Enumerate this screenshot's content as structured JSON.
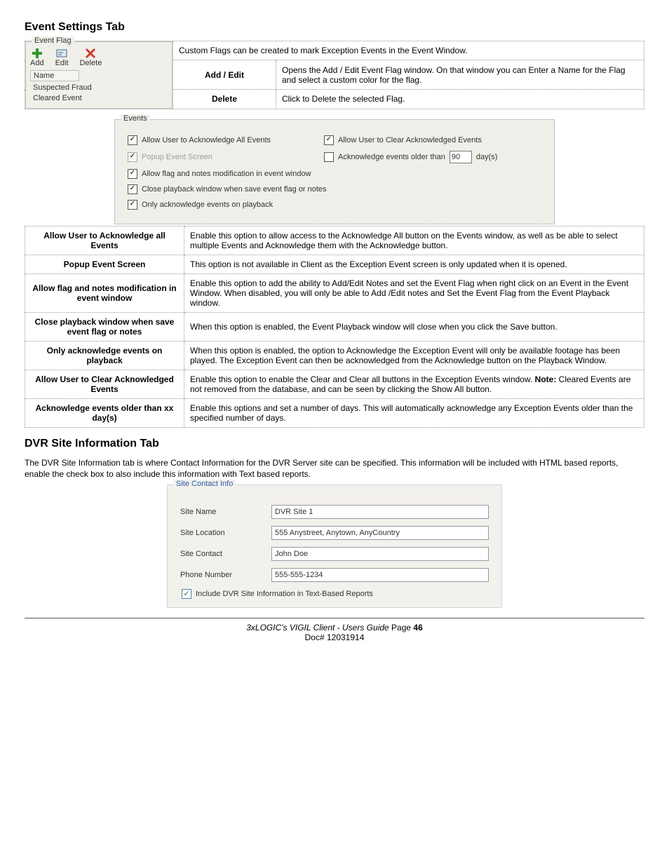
{
  "headings": {
    "event_settings": "Event Settings Tab",
    "dvr_site_info": "DVR Site Information Tab"
  },
  "flag_panel": {
    "legend": "Event Flag",
    "actions": {
      "add": "Add",
      "edit": "Edit",
      "delete": "Delete"
    },
    "list_header": "Name",
    "items": [
      "Suspected Fraud",
      "Cleared Event"
    ]
  },
  "flags_table": {
    "intro": "Custom Flags can be created to mark Exception Events in the Event Window.",
    "rows": [
      {
        "label": "Add / Edit",
        "desc": "Opens the Add / Edit Event Flag window.  On that window you can Enter a Name for the Flag and select a custom color for the flag."
      },
      {
        "label": "Delete",
        "desc": "Click to Delete the selected Flag."
      }
    ]
  },
  "events_panel": {
    "legend": "Events",
    "ack_all": "Allow User to Acknowledge All Events",
    "clear_ack": "Allow User to Clear Acknowledged Events",
    "popup": "Popup Event Screen",
    "ack_older": "Acknowledge events older than",
    "ack_older_val": "90",
    "ack_older_unit": "day(s)",
    "allow_flag_notes": "Allow flag and notes modification in event window",
    "close_playback": "Close playback window when save event flag or notes",
    "only_ack_playback": "Only acknowledge events on playback"
  },
  "options_table": [
    {
      "label": "Allow User to Acknowledge all Events",
      "desc": "Enable this option to allow access to the Acknowledge All button on the Events window, as well as be able to select multiple Events and Acknowledge them with the Acknowledge button."
    },
    {
      "label": "Popup Event Screen",
      "desc": "This option is not available in Client as the Exception Event screen is only updated when it is opened."
    },
    {
      "label": "Allow flag and notes modification in event window",
      "desc": "Enable this option to add the ability to Add/Edit Notes and set the Event Flag when right click on an Event in the Event Window.  When disabled, you will only be able to Add /Edit notes and Set the Event Flag from the Event Playback window."
    },
    {
      "label": "Close playback window when save event flag or notes",
      "desc": "When this option is enabled, the Event Playback window will close when you click the Save button."
    },
    {
      "label": "Only acknowledge events on playback",
      "desc": "When this option is enabled, the option to Acknowledge the Exception Event will only be available footage has been played.  The Exception Event can then be acknowledged from the Acknowledge button on the Playback Window."
    },
    {
      "label": "Allow User to Clear Acknowledged Events",
      "desc_pre": "Enable this option to enable the Clear and Clear all buttons in the Exception Events window.  ",
      "desc_bold": "Note:",
      "desc_post": " Cleared Events are not removed from the database, and can be seen by clicking the Show All button."
    },
    {
      "label": "Acknowledge events older than xx day(s)",
      "desc": "Enable this options and set a number of days.  This will automatically acknowledge any Exception Events older than the specified number of days."
    }
  ],
  "dvr_intro": "The DVR Site Information tab is where Contact Information for the DVR Server site can be specified.  This information will be included with HTML based reports, enable the check box to also include this information with Text based reports.",
  "site_panel": {
    "legend": "Site Contact Info",
    "fields": {
      "site_name": {
        "label": "Site Name",
        "value": "DVR Site 1"
      },
      "site_location": {
        "label": "Site Location",
        "value": "555 Anystreet, Anytown, AnyCountry"
      },
      "site_contact": {
        "label": "Site Contact",
        "value": "John Doe"
      },
      "phone": {
        "label": "Phone Number",
        "value": "555-555-1234"
      }
    },
    "include_text": "Include DVR Site Information in Text-Based Reports"
  },
  "footer": {
    "line1_pre": "3xLOGIC's VIGIL Client - Users Guide ",
    "line1_page_label": "Page ",
    "line1_page_num": "46",
    "line2": "Doc# 12031914"
  }
}
